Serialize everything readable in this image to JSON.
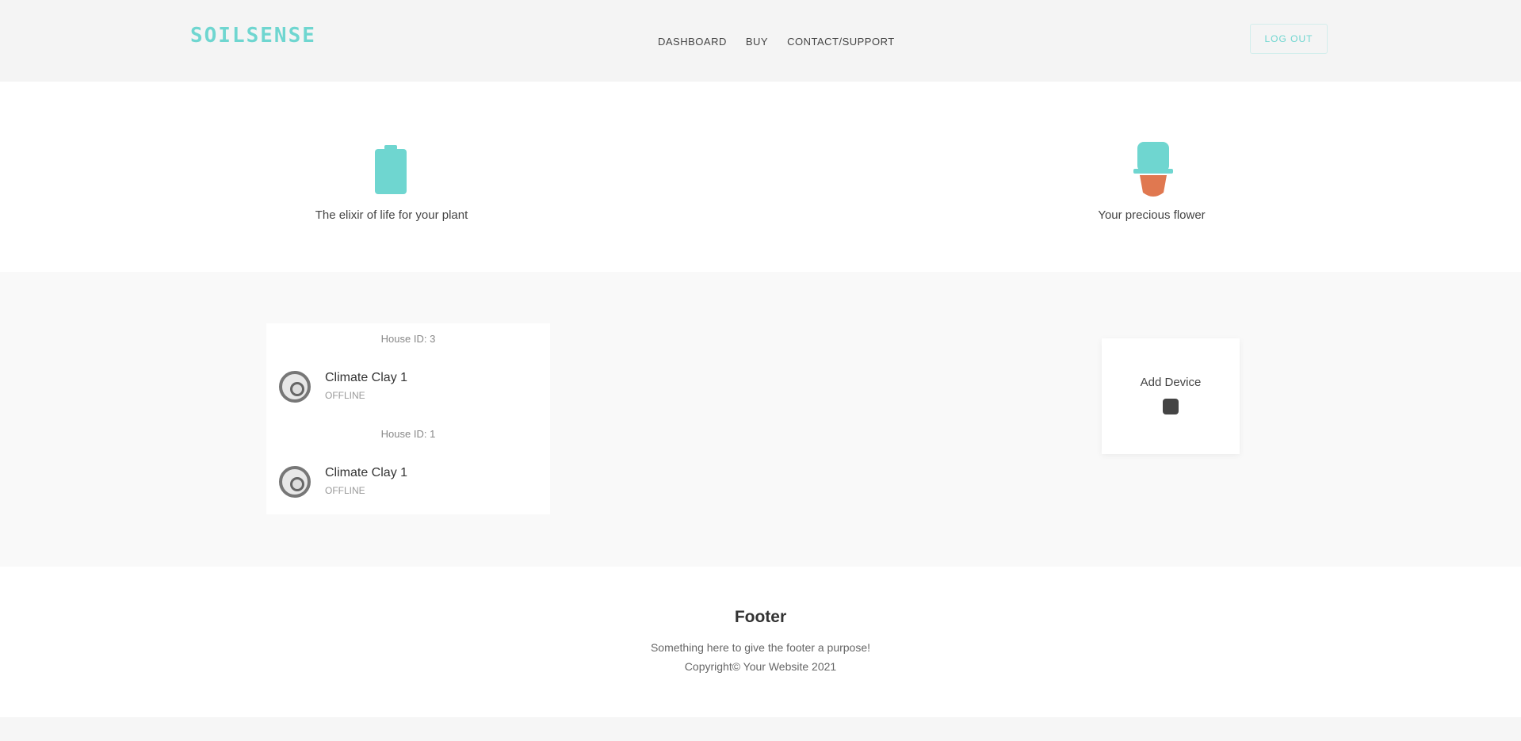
{
  "header": {
    "logo_text": "SOILSENSE",
    "nav": [
      {
        "label": "DASHBOARD"
      },
      {
        "label": "BUY"
      },
      {
        "label": "CONTACT/SUPPORT"
      }
    ],
    "logout_label": "LOG OUT"
  },
  "hero": {
    "features": [
      {
        "icon": "battery-icon",
        "text": "The elixir of life for your plant"
      },
      {
        "icon": "potted-plant-icon",
        "text": "Your precious flower"
      }
    ],
    "colors": {
      "accent": "#6fd6d0",
      "pot": "#e07850"
    }
  },
  "devices": {
    "groups": [
      {
        "title": "House ID: 3",
        "device": {
          "name": "Climate Clay 1",
          "status": "OFFLINE"
        }
      },
      {
        "title": "House ID: 1",
        "device": {
          "name": "Climate Clay 1",
          "status": "OFFLINE"
        }
      }
    ],
    "add_label": "Add Device"
  },
  "footer": {
    "title": "Footer",
    "line1": "Something here to give the footer a purpose!",
    "line2": "Copyright© Your Website 2021"
  }
}
